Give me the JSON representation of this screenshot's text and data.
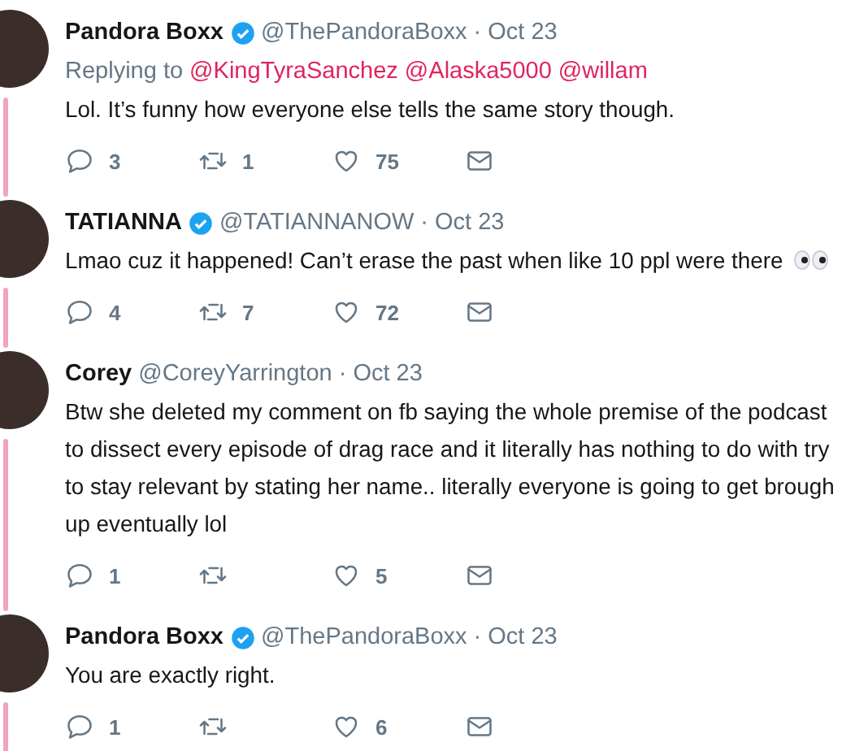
{
  "tweets": [
    {
      "name": "Pandora Boxx",
      "verified": true,
      "handle": "@ThePandoraBoxx",
      "date": "· Oct 23",
      "replying_to": {
        "label": "Replying to",
        "mentions": [
          "@KingTyraSanchez",
          "@Alaska5000",
          "@willam"
        ]
      },
      "text": [
        "Lol. It’s funny how everyone else tells the same story though."
      ],
      "emoji": false,
      "replies": "3",
      "retweets": "1",
      "likes": "75"
    },
    {
      "name": "TATIANNA",
      "verified": true,
      "handle": "@TATIANNANOW",
      "date": "· Oct 23",
      "text": [
        "Lmao cuz it happened! Can’t erase the past when like 10 ppl were there"
      ],
      "emoji": true,
      "replies": "4",
      "retweets": "7",
      "likes": "72"
    },
    {
      "name": "Corey",
      "verified": false,
      "handle": "@CoreyYarrington",
      "date": "· Oct 23",
      "text": [
        "Btw she deleted my comment on fb saying the whole premise of the podcast",
        "to dissect every episode of drag race and it literally has nothing to do with try",
        "to stay relevant by stating her name.. literally everyone is going to get brough",
        "up eventually lol"
      ],
      "emoji": false,
      "replies": "1",
      "likes": "5"
    },
    {
      "name": "Pandora Boxx",
      "verified": true,
      "handle": "@ThePandoraBoxx",
      "date": "· Oct 23",
      "text": [
        "You are exactly right."
      ],
      "emoji": false,
      "replies": "1",
      "likes": "6"
    }
  ]
}
